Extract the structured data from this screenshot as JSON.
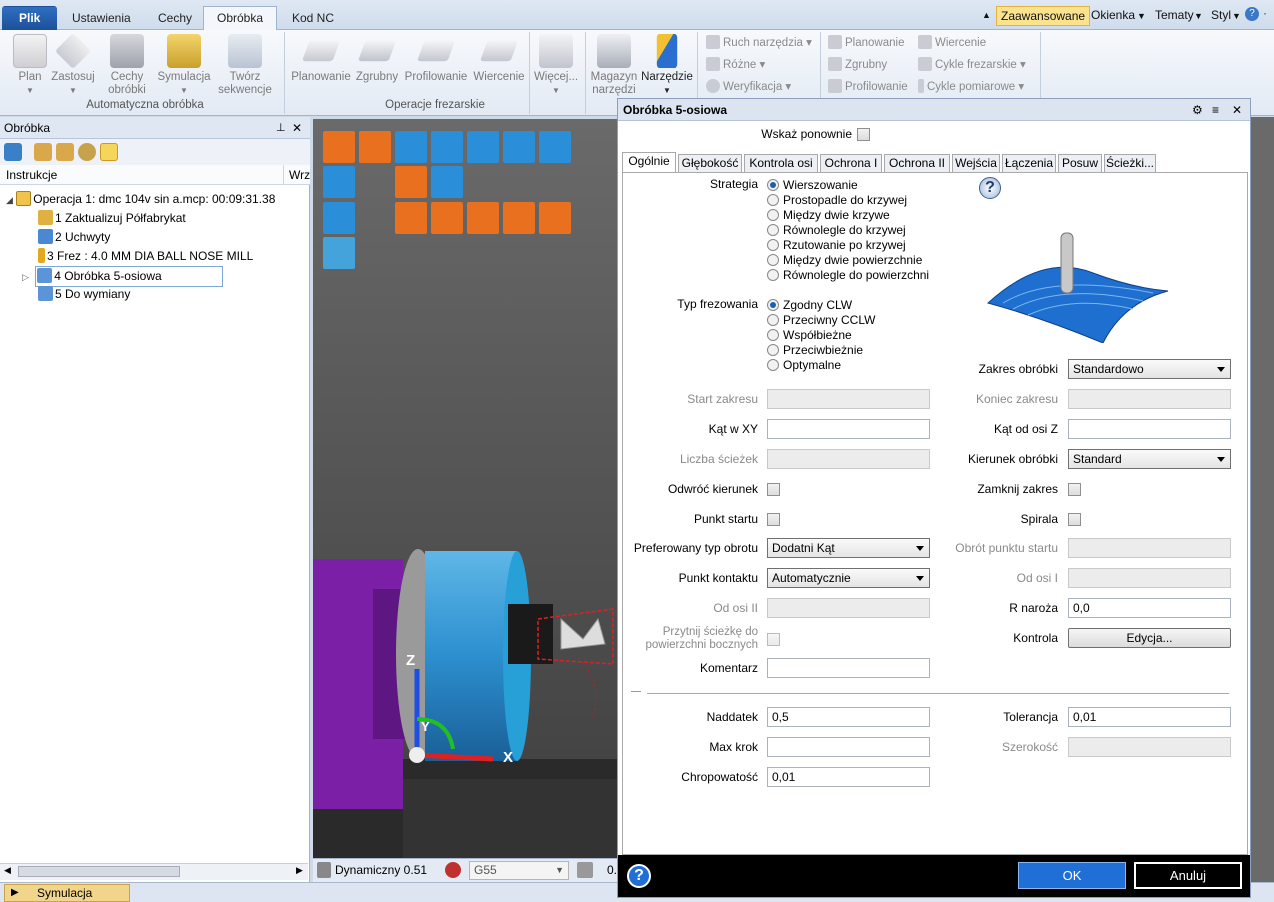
{
  "tabs": {
    "file": "Plik",
    "t1": "Ustawienia",
    "t2": "Cechy",
    "t3": "Obróbka",
    "t4": "Kod NC"
  },
  "quickaccess": {
    "advanced": "Zaawansowane",
    "windows": "Okienka",
    "themes": "Tematy",
    "style": "Styl"
  },
  "ribbon": {
    "plan": "Plan",
    "apply": "Zastosuj",
    "features": "Cechy obróbki",
    "simulation": "Symulacja",
    "sequence": "Twórz sekwencje",
    "group1": "Automatyczna obróbka",
    "planing": "Planowanie",
    "roughing": "Zgrubny",
    "profiling": "Profilowanie",
    "drilling": "Wiercenie",
    "more": "Więcej...",
    "group2": "Operacje frezarskie",
    "magazine": "Magazyn narzędzi",
    "tool": "Narzędzie",
    "toolmove": "Ruch narzędzia",
    "misc": "Różne",
    "verify": "Weryfikacja",
    "planing2": "Planowanie",
    "roughing2": "Zgrubny",
    "profiling2": "Profilowanie",
    "drilling2": "Wiercenie",
    "millcycles": "Cykle frezarskie",
    "measurecycles": "Cykle pomiarowe"
  },
  "left": {
    "title": "Obróbka",
    "col1": "Instrukcje",
    "col2": "Wrz",
    "items": [
      "Operacja 1: dmc 104v sin a.mcp: 00:09:31.38",
      "1 Zaktualizuj Półfabrykat",
      "2 Uchwyty",
      "3 Frez : 4.0 MM DIA BALL NOSE MILL",
      "4 Obróbka 5-osiowa",
      "5 Do wymiany"
    ]
  },
  "viewport": {
    "mode": "Dynamiczny 0.51",
    "wcs": "G55",
    "extra": "0.",
    "axis_x": "X",
    "axis_y": "Y",
    "axis_z": "Z"
  },
  "bottom": {
    "sim": "Symulacja"
  },
  "dialog": {
    "title": "Obróbka 5-osiowa",
    "show_again": "Wskaż ponownie",
    "tabs": [
      "Ogólnie",
      "Głębokość",
      "Kontrola osi",
      "Ochrona I",
      "Ochrona II",
      "Wejścia",
      "Łączenia",
      "Posuw",
      "Ścieżki..."
    ],
    "strategy_label": "Strategia",
    "strategies": [
      "Wierszowanie",
      "Prostopadle do krzywej",
      "Między dwie krzywe",
      "Równolegle do krzywej",
      "Rzutowanie po krzywej",
      "Między dwie powierzchnie",
      "Równolegle do powierzchni"
    ],
    "millingtype_label": "Typ frezowania",
    "millingtypes": [
      "Zgodny CLW",
      "Przeciwny CCLW",
      "Współbieżne",
      "Przeciwbieżnie",
      "Optymalne"
    ],
    "range_label": "Zakres obróbki",
    "range_value": "Standardowo",
    "start_range": "Start zakresu",
    "end_range": "Koniec zakresu",
    "angle_xy": "Kąt w XY",
    "angle_z": "Kąt od osi Z",
    "paths_count": "Liczba ścieżek",
    "direction_label": "Kierunek obróbki",
    "direction_value": "Standard",
    "reverse": "Odwróć kierunek",
    "close_range": "Zamknij zakres",
    "start_point": "Punkt startu",
    "spiral": "Spirala",
    "pref_rotation": "Preferowany typ obrotu",
    "pref_rotation_value": "Dodatni Kąt",
    "start_rotation": "Obrót punktu startu",
    "contact_point": "Punkt kontaktu",
    "contact_value": "Automatycznie",
    "from_axis_1": "Od osi I",
    "from_axis_2": "Od osi II",
    "corner_r": "R naroża",
    "corner_r_value": "0,0",
    "trim": "Przytnij ścieżkę do powierzchni bocznych",
    "control": "Kontrola",
    "edit": "Edycja...",
    "comment": "Komentarz",
    "allowance": "Naddatek",
    "allowance_value": "0,5",
    "tolerance": "Tolerancja",
    "tolerance_value": "0,01",
    "maxstep": "Max krok",
    "width": "Szerokość",
    "roughness": "Chropowatość",
    "roughness_value": "0,01",
    "ok": "OK",
    "cancel": "Anuluj"
  },
  "colors": {
    "accent": "#1a5fb4",
    "ok_blue": "#1f6fd6",
    "tool_orange": "#e8701f",
    "tool_blue": "#2a8fd8"
  }
}
